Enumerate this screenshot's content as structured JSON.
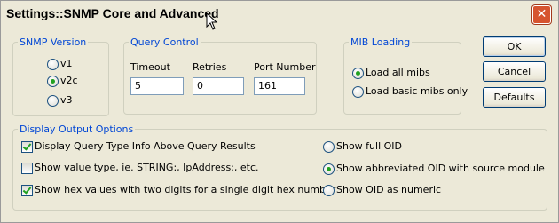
{
  "window": {
    "title": "Settings::SNMP Core and Advanced",
    "close_glyph": "✕"
  },
  "snmp_version": {
    "legend": "SNMP Version",
    "options": [
      {
        "label": "v1",
        "selected": false
      },
      {
        "label": "v2c",
        "selected": true
      },
      {
        "label": "v3",
        "selected": false
      }
    ]
  },
  "query_control": {
    "legend": "Query Control",
    "timeout": {
      "label": "Timeout",
      "value": "5"
    },
    "retries": {
      "label": "Retries",
      "value": "0"
    },
    "port": {
      "label": "Port Number",
      "value": "161"
    }
  },
  "mib_loading": {
    "legend": "MIB Loading",
    "options": [
      {
        "label": "Load all mibs",
        "selected": true
      },
      {
        "label": "Load basic mibs only",
        "selected": false
      }
    ]
  },
  "buttons": {
    "ok": "OK",
    "cancel": "Cancel",
    "defaults": "Defaults"
  },
  "display_output": {
    "legend": "Display Output Options",
    "checkboxes": [
      {
        "label": "Display Query Type Info Above Query Results",
        "checked": true
      },
      {
        "label": "Show value type, ie. STRING:, IpAddress:, etc.",
        "checked": false
      },
      {
        "label": "Show hex values with two digits for a single digit hex number",
        "checked": true
      }
    ],
    "oid_options": [
      {
        "label": "Show full OID",
        "selected": false
      },
      {
        "label": "Show abbreviated OID with source module",
        "selected": true
      },
      {
        "label": "Show OID as numeric",
        "selected": false
      }
    ]
  }
}
